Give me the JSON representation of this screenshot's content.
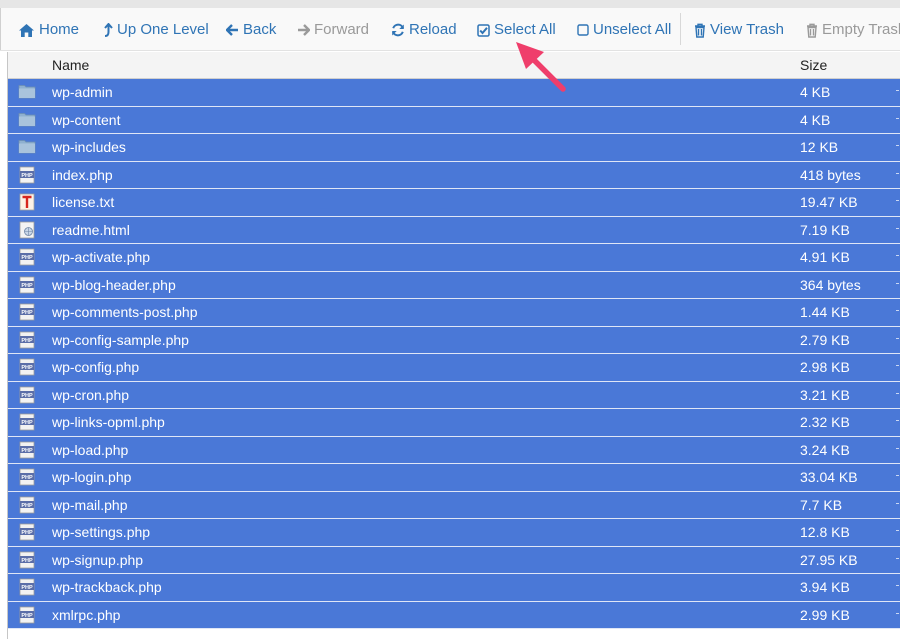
{
  "toolbar": {
    "buttons": [
      {
        "label": "Home",
        "icon": "home-icon",
        "enabled": true
      },
      {
        "label": "Up One Level",
        "icon": "up-arrow-icon",
        "enabled": true
      },
      {
        "label": "Back",
        "icon": "back-arrow-icon",
        "enabled": true
      },
      {
        "label": "Forward",
        "icon": "forward-arrow-icon",
        "enabled": false
      },
      {
        "label": "Reload",
        "icon": "reload-icon",
        "enabled": true
      },
      {
        "label": "Select All",
        "icon": "checked-box-icon",
        "enabled": true
      },
      {
        "label": "Unselect All",
        "icon": "empty-box-icon",
        "enabled": true
      },
      {
        "label": "View Trash",
        "icon": "trash-icon",
        "enabled": true
      },
      {
        "label": "Empty Trash",
        "icon": "trash-icon",
        "enabled": false
      }
    ]
  },
  "table": {
    "headers": {
      "name": "Name",
      "size": "Size"
    },
    "selection_color": "#4a78d7",
    "rows": [
      {
        "name": "wp-admin",
        "size": "4 KB",
        "type": "folder"
      },
      {
        "name": "wp-content",
        "size": "4 KB",
        "type": "folder"
      },
      {
        "name": "wp-includes",
        "size": "12 KB",
        "type": "folder"
      },
      {
        "name": "index.php",
        "size": "418 bytes",
        "type": "php"
      },
      {
        "name": "license.txt",
        "size": "19.47 KB",
        "type": "txt"
      },
      {
        "name": "readme.html",
        "size": "7.19 KB",
        "type": "html"
      },
      {
        "name": "wp-activate.php",
        "size": "4.91 KB",
        "type": "php"
      },
      {
        "name": "wp-blog-header.php",
        "size": "364 bytes",
        "type": "php"
      },
      {
        "name": "wp-comments-post.php",
        "size": "1.44 KB",
        "type": "php"
      },
      {
        "name": "wp-config-sample.php",
        "size": "2.79 KB",
        "type": "php"
      },
      {
        "name": "wp-config.php",
        "size": "2.98 KB",
        "type": "php"
      },
      {
        "name": "wp-cron.php",
        "size": "3.21 KB",
        "type": "php"
      },
      {
        "name": "wp-links-opml.php",
        "size": "2.32 KB",
        "type": "php"
      },
      {
        "name": "wp-load.php",
        "size": "3.24 KB",
        "type": "php"
      },
      {
        "name": "wp-login.php",
        "size": "33.04 KB",
        "type": "php"
      },
      {
        "name": "wp-mail.php",
        "size": "7.7 KB",
        "type": "php"
      },
      {
        "name": "wp-settings.php",
        "size": "12.8 KB",
        "type": "php"
      },
      {
        "name": "wp-signup.php",
        "size": "27.95 KB",
        "type": "php"
      },
      {
        "name": "wp-trackback.php",
        "size": "3.94 KB",
        "type": "php"
      },
      {
        "name": "xmlrpc.php",
        "size": "2.99 KB",
        "type": "php"
      }
    ]
  },
  "annotation": {
    "arrow_color": "#ef3e6b"
  }
}
